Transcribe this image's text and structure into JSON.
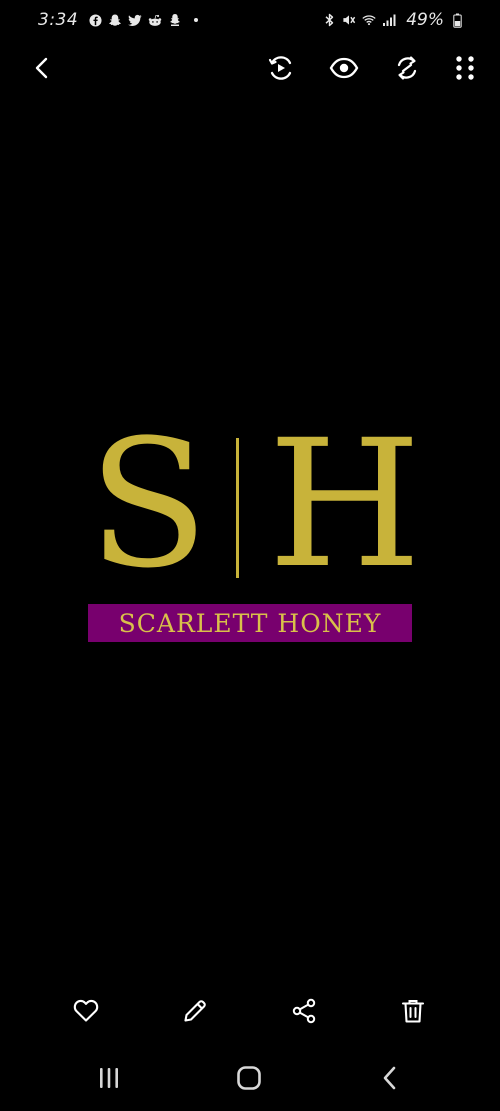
{
  "status_bar": {
    "time": "3:34",
    "battery": "49%",
    "notification_icons": [
      "facebook-icon",
      "snapchat-icon",
      "twitter-icon",
      "reddit-icon",
      "snapchat-icon"
    ],
    "system_icons": [
      "bluetooth-icon",
      "mute-icon",
      "wifi-icon",
      "signal-icon",
      "battery-icon"
    ]
  },
  "top_toolbar": {
    "buttons": [
      "back-icon",
      "remaster-icon",
      "visibility-icon",
      "rotate-icon",
      "more-options-icon"
    ]
  },
  "logo": {
    "letter_left": "S",
    "letter_right": "H",
    "brand_name": "SCARLETT HONEY",
    "gold_color": "#c8b33a",
    "band_color": "#78006e"
  },
  "action_bar": {
    "buttons": [
      "favorite-icon",
      "edit-icon",
      "share-icon",
      "delete-icon"
    ]
  },
  "nav_bar": {
    "buttons": [
      "recent-apps-icon",
      "home-icon",
      "back-icon"
    ]
  }
}
